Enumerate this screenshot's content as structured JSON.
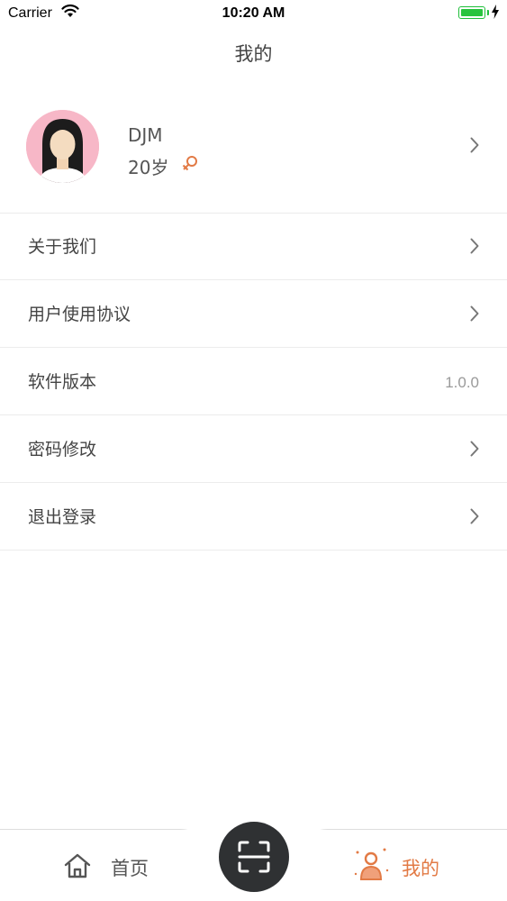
{
  "status_bar": {
    "carrier": "Carrier",
    "time": "10:20 AM"
  },
  "header": {
    "title": "我的"
  },
  "profile": {
    "name": "DJM",
    "age": "20岁",
    "gender": "female",
    "gender_icon_color": "#e27a45"
  },
  "menu": {
    "items": [
      {
        "label": "关于我们"
      },
      {
        "label": "用户使用协议"
      },
      {
        "label": "软件版本",
        "value": "1.0.0"
      },
      {
        "label": "密码修改"
      },
      {
        "label": "退出登录"
      }
    ]
  },
  "tab_bar": {
    "home_label": "首页",
    "mine_label": "我的",
    "active_tab": "mine",
    "active_color": "#e27a45",
    "center_button_color": "#2f3133"
  }
}
